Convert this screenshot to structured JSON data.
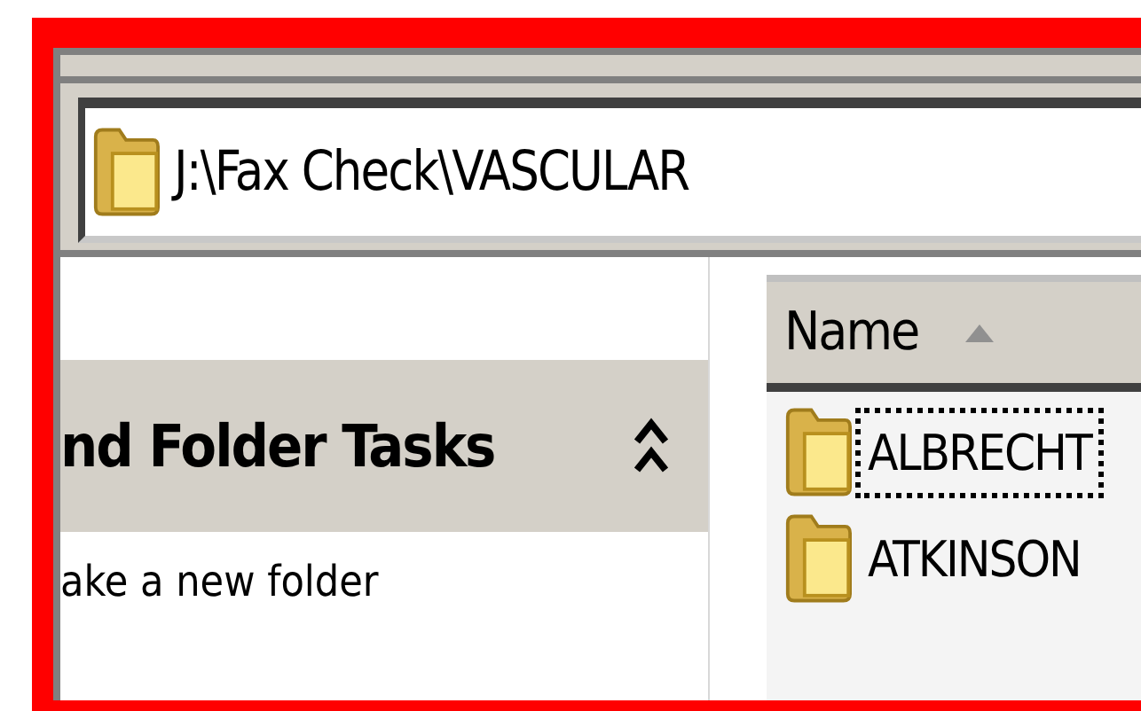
{
  "address_bar": {
    "path": "J:\\Fax Check\\VASCULAR"
  },
  "task_pane": {
    "title": "nd Folder Tasks",
    "expanded": true,
    "tasks": [
      "ake a new folder"
    ]
  },
  "file_list": {
    "columns": [
      {
        "label": "Name",
        "sorted": true
      }
    ],
    "rows": [
      {
        "name": "ALBRECHT",
        "focused": true
      },
      {
        "name": "ATKINSON",
        "focused": false
      }
    ]
  }
}
